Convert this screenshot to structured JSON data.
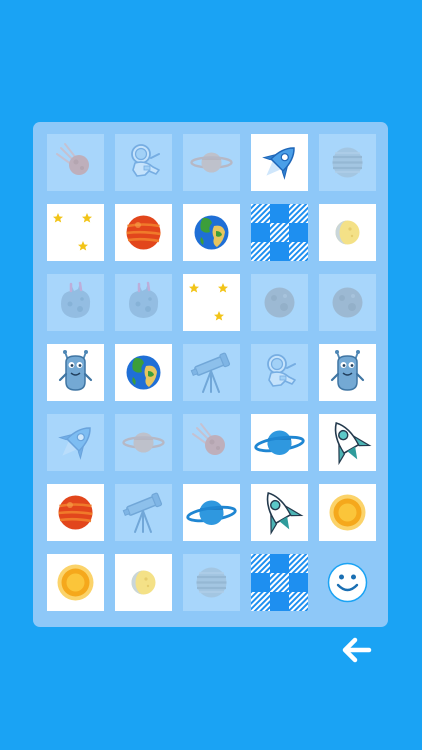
{
  "game": {
    "theme": "space",
    "columns": 5,
    "rows": 7,
    "tiles": [
      {
        "icon": "meteor-icon",
        "state": "matched"
      },
      {
        "icon": "astronaut-icon",
        "state": "matched"
      },
      {
        "icon": "saturn-icon",
        "state": "matched"
      },
      {
        "icon": "rocket-icon",
        "state": "face-up"
      },
      {
        "icon": "gas-planet-icon",
        "state": "matched"
      },
      {
        "icon": "stars-icon",
        "state": "face-up"
      },
      {
        "icon": "red-planet-icon",
        "state": "face-up"
      },
      {
        "icon": "earth-icon",
        "state": "face-up"
      },
      {
        "icon": "card-back-pattern",
        "state": "face-down"
      },
      {
        "icon": "moon-icon",
        "state": "face-up"
      },
      {
        "icon": "asteroid-icon",
        "state": "matched"
      },
      {
        "icon": "asteroid-icon",
        "state": "matched"
      },
      {
        "icon": "stars-icon",
        "state": "face-up"
      },
      {
        "icon": "grey-planet-icon",
        "state": "matched"
      },
      {
        "icon": "grey-planet-icon",
        "state": "matched"
      },
      {
        "icon": "alien-icon",
        "state": "face-up"
      },
      {
        "icon": "earth-icon",
        "state": "face-up"
      },
      {
        "icon": "telescope-icon",
        "state": "matched"
      },
      {
        "icon": "astronaut-icon",
        "state": "matched"
      },
      {
        "icon": "alien-icon",
        "state": "face-up"
      },
      {
        "icon": "rocket-icon",
        "state": "matched"
      },
      {
        "icon": "saturn-icon",
        "state": "matched"
      },
      {
        "icon": "meteor-icon",
        "state": "matched"
      },
      {
        "icon": "blue-ringed-planet-icon",
        "state": "face-up"
      },
      {
        "icon": "spaceship-icon",
        "state": "face-up"
      },
      {
        "icon": "red-planet-icon",
        "state": "face-up"
      },
      {
        "icon": "telescope-icon",
        "state": "matched"
      },
      {
        "icon": "blue-ringed-planet-icon",
        "state": "face-up"
      },
      {
        "icon": "spaceship-icon",
        "state": "face-up"
      },
      {
        "icon": "sun-icon",
        "state": "face-up"
      },
      {
        "icon": "sun-icon",
        "state": "face-up"
      },
      {
        "icon": "moon-icon",
        "state": "face-up"
      },
      {
        "icon": "gas-planet-icon",
        "state": "matched"
      },
      {
        "icon": "card-back-pattern",
        "state": "face-down"
      },
      {
        "icon": "smiley-face-icon",
        "state": "solved"
      }
    ]
  },
  "navigation": {
    "back_icon": "arrow-left-icon"
  },
  "colors": {
    "background": "#1aa3f4",
    "board": "#8ec8f8",
    "matched_tile": "#a8d6fb",
    "card_back": "#1e8ff0"
  }
}
